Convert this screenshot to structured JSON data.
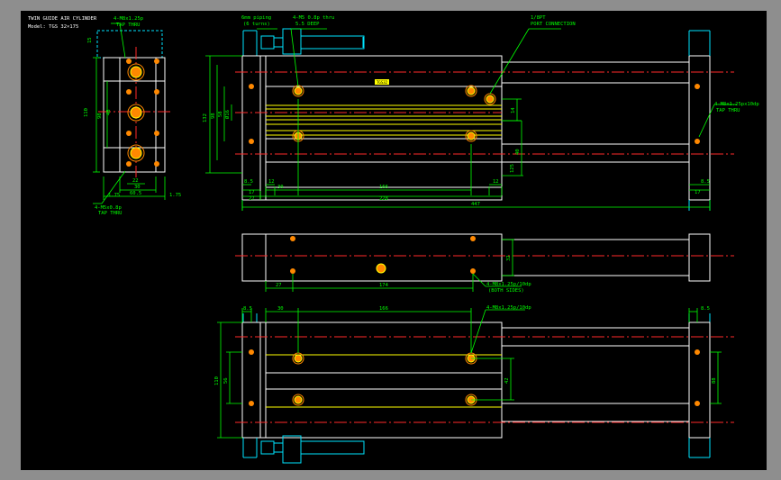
{
  "viewport": {
    "background": "#8e8e8e",
    "sheet_background": "#000000"
  },
  "colors": {
    "outline": "#ffffff",
    "dim": "#00ff00",
    "center": "#ff2a2a",
    "yellow": "#ffff00",
    "hidden": "#00e5ff",
    "hole": "#ff8800",
    "rod": "#ffff00"
  },
  "title_block": {
    "line1": "TWIN GUIDE AIR CYLINDER",
    "line2": "Model: TGS 32×175"
  },
  "side_view": {
    "callout_top": "4-M8x1.25p",
    "callout_top_sub": "TAP THRU",
    "callout_bottom": "4-M5x0.8p",
    "callout_bottom_sub": "TAP THRU",
    "dims": {
      "top": "15",
      "h_outer": "110",
      "h_inner": "98",
      "h_mid": "48",
      "w1": "22",
      "w2": "30",
      "w3": "60.5",
      "edge_l": "1.75",
      "edge_r": "1.75"
    }
  },
  "main_view": {
    "callouts": {
      "air_port": "1/8PT",
      "air_port_sub": "PORT CONNECTION",
      "screw": "4-M5 0.8p thru",
      "screw_sub": "5.5 DEEP",
      "piping": "6mm piping",
      "piping_sub": "(6 turns)",
      "tap_right": "4-M8x1.25px10dp",
      "tap_right_sub": "TAP THRU"
    },
    "dims": {
      "h_total": "132",
      "h_a": "98",
      "h_b": "58",
      "h_c": "Ø16",
      "d_12_left": "12",
      "d_12_right": "12",
      "d_14": "14",
      "d_40": "40",
      "d_125": "125",
      "d_8": "8.5",
      "d_30": "30",
      "d_17": "17",
      "d_27": "27",
      "d_166": "166",
      "d_17_right": "17",
      "d_8_right": "8.5",
      "d_228": "228",
      "d_447": "447"
    },
    "label": "TGS32"
  },
  "top_view": {
    "callout": "4-M8x1.25p/10dp",
    "callout_sub": "(BOTH SIDES)",
    "dims": {
      "d_27": "27",
      "d_174": "174",
      "d_32": "32"
    }
  },
  "bottom_view": {
    "callout": "4-M8x1.25p/10dp",
    "dims": {
      "d_8_left": "8.5",
      "d_30": "30",
      "d_166": "166",
      "d_110": "110",
      "d_56": "56",
      "d_42": "42",
      "d_8_right": "8.5",
      "d_88": "88"
    }
  }
}
